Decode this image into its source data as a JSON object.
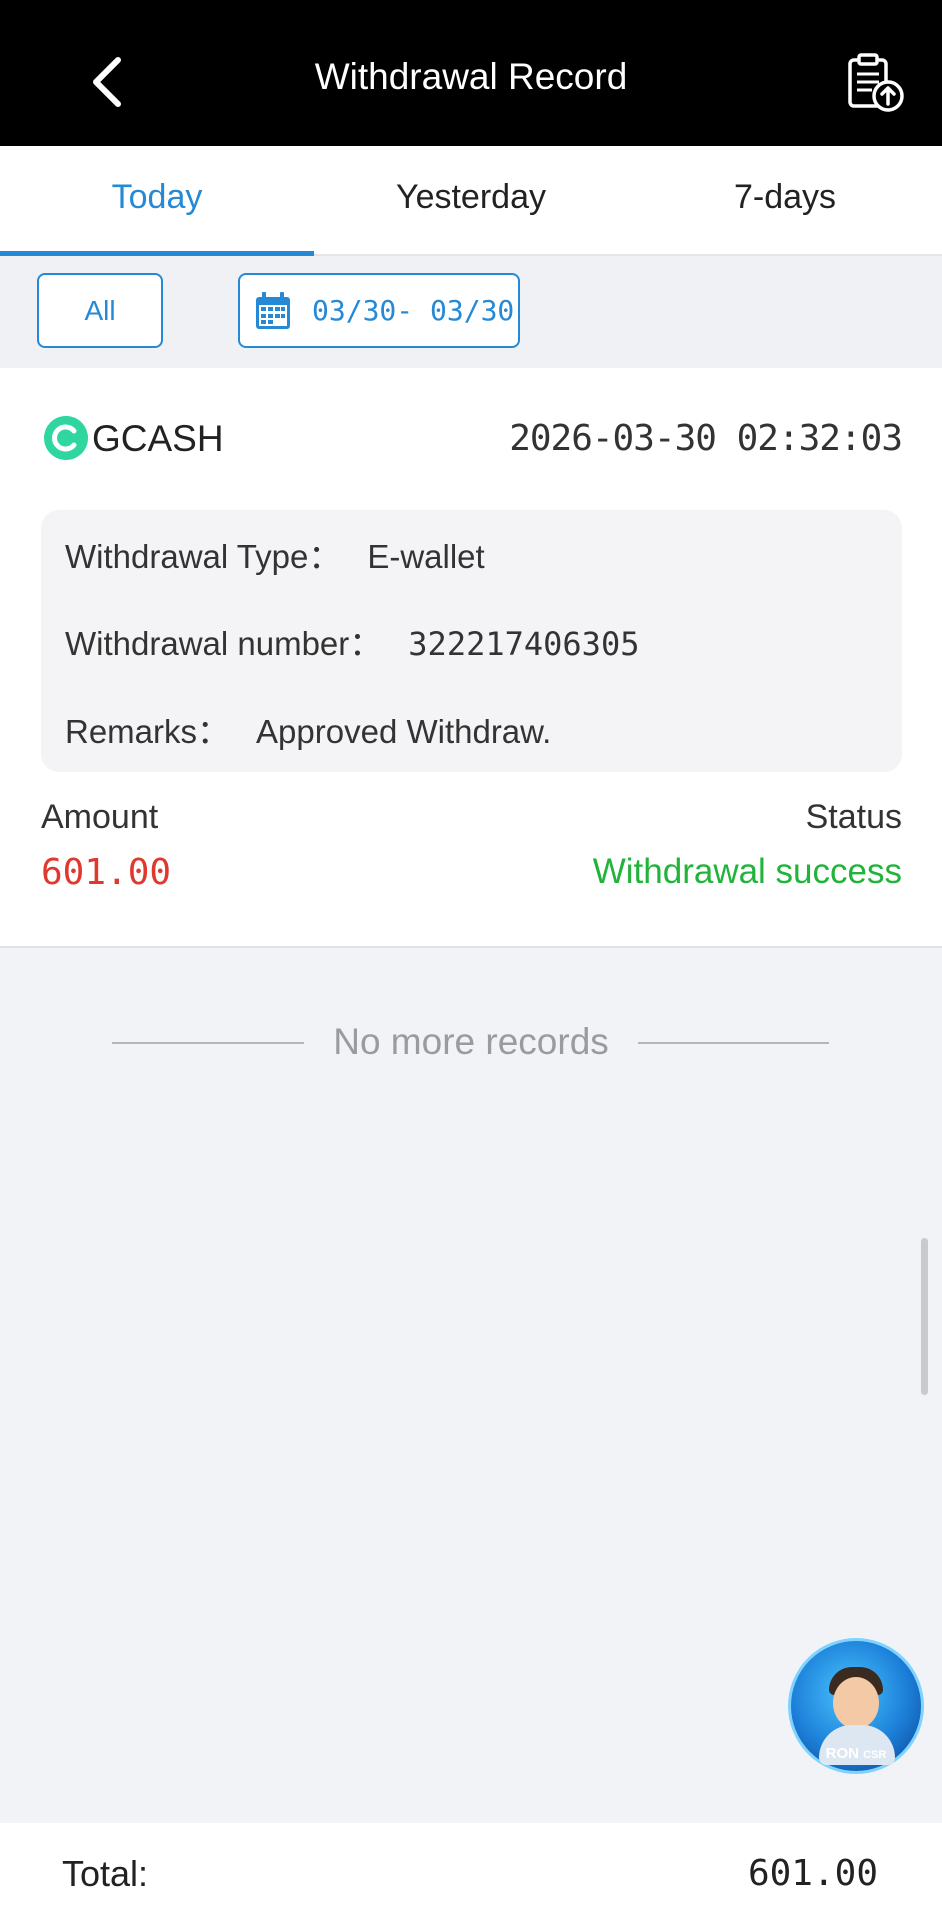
{
  "header": {
    "title": "Withdrawal Record",
    "back_icon": "chevron-left-icon",
    "action_icon": "clipboard-upload-icon"
  },
  "tabs": [
    {
      "label": "Today",
      "active": true
    },
    {
      "label": "Yesterday",
      "active": false
    },
    {
      "label": "7-days",
      "active": false
    }
  ],
  "filters": {
    "type_label": "All",
    "date_range": "03/30- 03/30",
    "date_icon": "calendar-icon"
  },
  "record": {
    "method": "GCASH",
    "timestamp": "2026-03-30 02:32:03",
    "type_label": "Withdrawal Type：",
    "type_value": "E-wallet",
    "number_label": "Withdrawal number：",
    "number_value": "322217406305",
    "remarks_label": "Remarks：",
    "remarks_value": "Approved Withdraw.",
    "amount_label": "Amount",
    "amount_value": "601.00",
    "status_label": "Status",
    "status_value": "Withdrawal success"
  },
  "list_end_text": "No more records",
  "support": {
    "name": "RON",
    "role": "CSR"
  },
  "footer": {
    "total_label": "Total:",
    "total_value": "601.00"
  },
  "colors": {
    "accent": "#2589d6",
    "amount": "#e0382e",
    "success": "#21b33a",
    "header_bg": "#000000"
  }
}
